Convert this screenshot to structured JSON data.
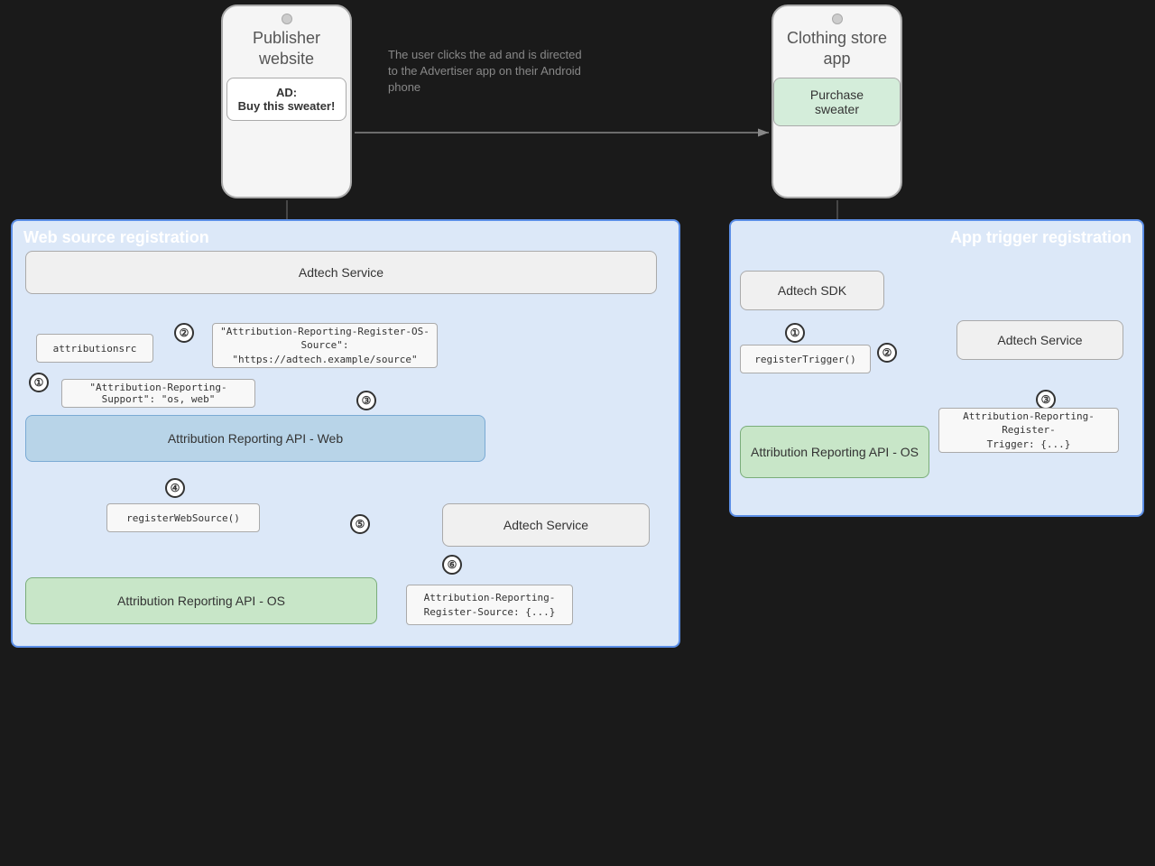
{
  "publisher_phone": {
    "title": "Publisher website",
    "ad_label": "AD:",
    "ad_text": "Buy this sweater!"
  },
  "store_phone": {
    "title": "Clothing store app",
    "button_text": "Purchase sweater"
  },
  "annotation": {
    "text": "The user clicks the ad and is directed to the Advertiser app on their Android phone"
  },
  "web_source_box": {
    "label": "Web source registration"
  },
  "app_trigger_box": {
    "label": "App trigger registration"
  },
  "left_panel": {
    "adtech_service_top": "Adtech Service",
    "attribution_src_code": "attributionsrc",
    "header_code": "\"Attribution-Reporting-Register-OS-Source\":\n\"https://adtech.example/source\"",
    "support_code": "\"Attribution-Reporting-Support\": \"os, web\"",
    "api_web": "Attribution Reporting API - Web",
    "register_web_source": "registerWebSource()",
    "adtech_service_bottom": "Adtech Service",
    "register_source_code": "Attribution-Reporting-\nRegister-Source: {...}",
    "api_os": "Attribution Reporting API - OS"
  },
  "right_panel": {
    "adtech_sdk": "Adtech SDK",
    "register_trigger": "registerTrigger()",
    "adtech_service": "Adtech Service",
    "register_trigger_code": "Attribution-Reporting-Register-\nTrigger: {...}",
    "api_os": "Attribution Reporting API - OS"
  },
  "step_numbers": {
    "left_1": "①",
    "left_2": "②",
    "left_3": "③",
    "left_4": "④",
    "left_5": "⑤",
    "left_6": "⑥",
    "right_1": "①",
    "right_2": "②",
    "right_3": "③"
  }
}
